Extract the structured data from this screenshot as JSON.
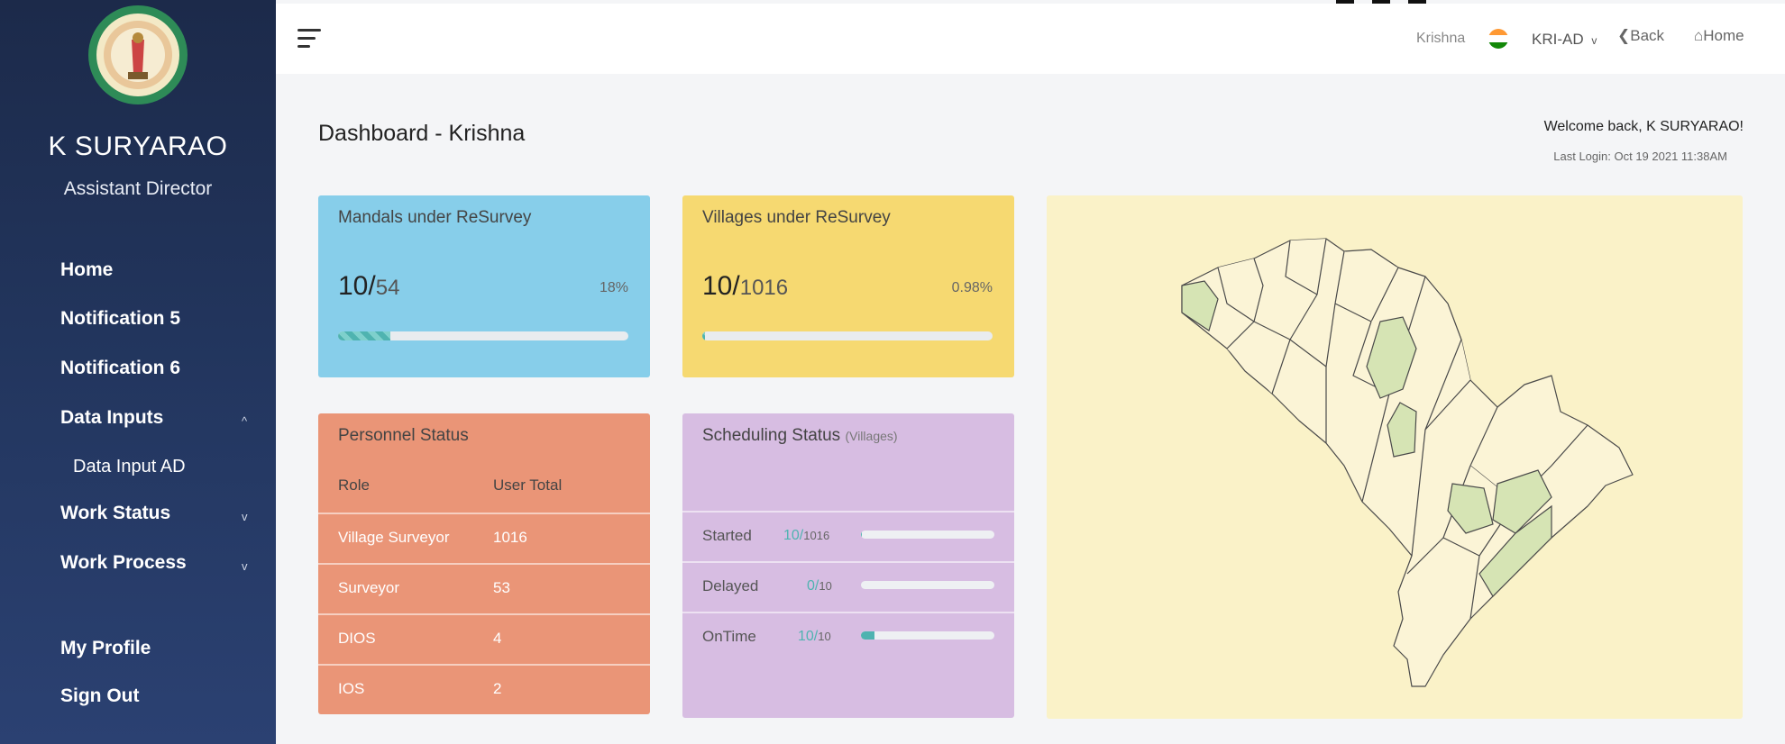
{
  "sidebar": {
    "logo": {
      "icon": "state-emblem-logo"
    },
    "user_name": "K SURYARAO",
    "user_role": "Assistant Director",
    "items": [
      {
        "label": "Home"
      },
      {
        "label": "Notification 5"
      },
      {
        "label": "Notification 6"
      },
      {
        "label": "Data Inputs",
        "caret": "^"
      },
      {
        "label": "Data Input AD"
      },
      {
        "label": "Work Status",
        "caret": "v"
      },
      {
        "label": "Work Process",
        "caret": "v"
      },
      {
        "label": "My Profile"
      },
      {
        "label": "Sign Out"
      }
    ]
  },
  "topbar": {
    "user": "Krishna",
    "district": "KRI-AD",
    "district_caret": "v",
    "back_label": "Back",
    "home_label": "Home"
  },
  "header": {
    "title": "Dashboard - Krishna",
    "welcome": "Welcome back, K SURYARAO!",
    "last_login": "Last Login: Oct 19 2021 11:38AM"
  },
  "cards": {
    "mandals": {
      "title": "Mandals under ReSurvey",
      "value": "10/",
      "total": "54",
      "percent": "18%",
      "progress": 0.18,
      "color": "#87ceea"
    },
    "villages": {
      "title": "Villages under ReSurvey",
      "value": "10/",
      "total": "1016",
      "percent": "0.98%",
      "progress": 0.0098,
      "color": "#f6d971"
    },
    "personnel": {
      "title": "Personnel Status",
      "headers": [
        "Role",
        "User Total"
      ],
      "rows": [
        {
          "role": "Village Surveyor",
          "total": "1016"
        },
        {
          "role": "Surveyor",
          "total": "53"
        },
        {
          "role": "DIOS",
          "total": "4"
        },
        {
          "role": "IOS",
          "total": "2"
        }
      ],
      "color": "#ea9577"
    },
    "scheduling": {
      "title": "Scheduling Status",
      "subtitle": "(Villages)",
      "rows": [
        {
          "label": "Started",
          "value": "10/",
          "total": "1016",
          "progress": 0.01
        },
        {
          "label": "Delayed",
          "value": "0/",
          "total": "10",
          "progress": 0
        },
        {
          "label": "OnTime",
          "value": "10/",
          "total": "10",
          "progress": 0.1
        }
      ],
      "color": "#d7bde2"
    }
  },
  "colors": {
    "sidebar_top": "#1c2a4a",
    "sidebar_bottom": "#2b4172",
    "accent": "#4fb3b0",
    "map_bg": "#faf2c8",
    "map_highlight": "#d6e4b4"
  }
}
